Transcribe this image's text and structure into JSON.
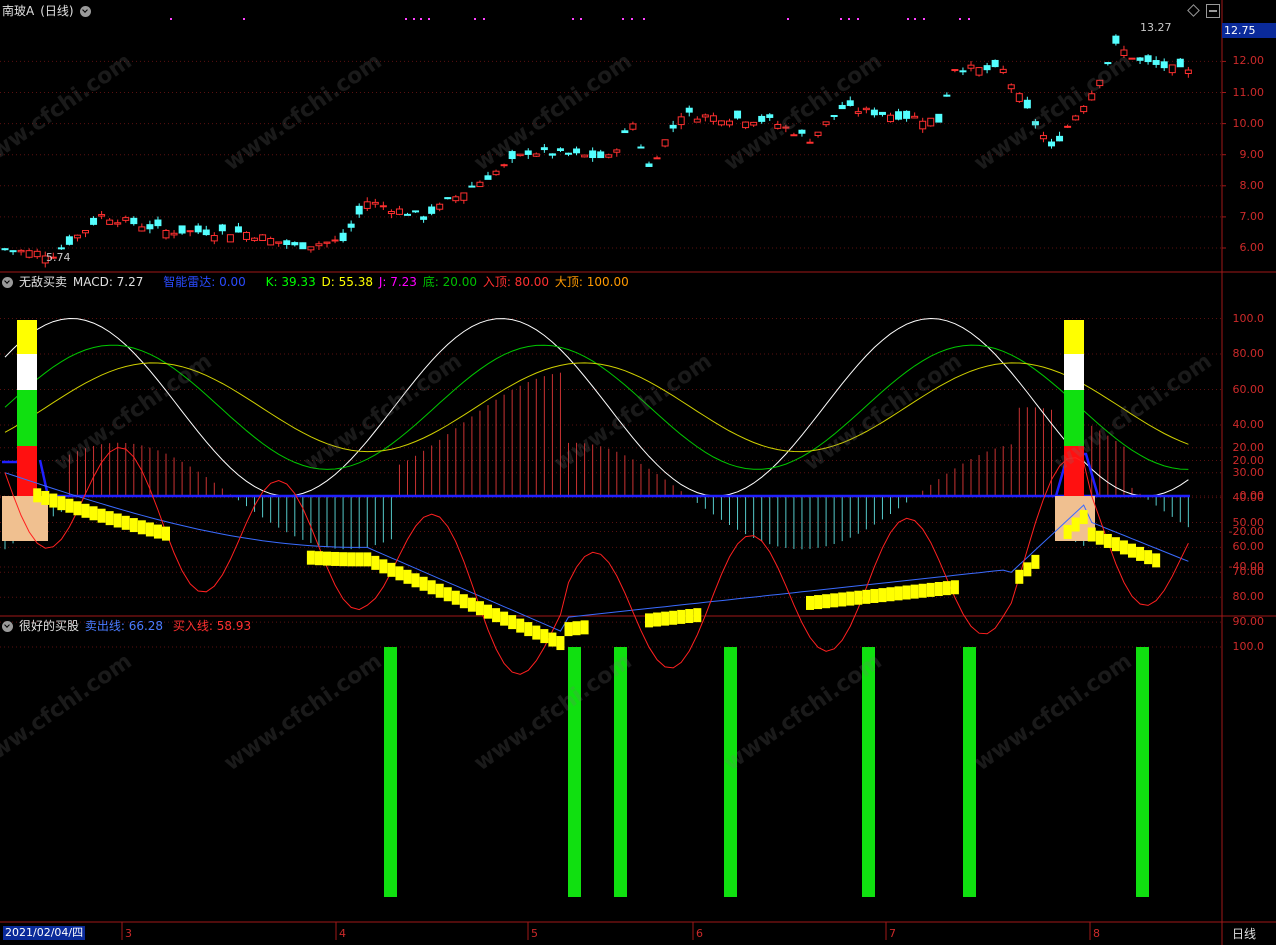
{
  "header": {
    "stock_name": "南玻A",
    "period": "(日线)"
  },
  "price_panel": {
    "current_price_tag": "12.75",
    "high_marker": "13.27",
    "low_marker": "5.74",
    "y_ticks": [
      "12.00",
      "11.00",
      "10.00",
      "9.00",
      "8.00",
      "7.00",
      "6.00"
    ]
  },
  "indicator1": {
    "name": "无敌买卖",
    "macd": "MACD: 7.27",
    "radar": "智能雷达: 0.00",
    "k": "K: 39.33",
    "d": "D: 55.38",
    "j": "J: 7.23",
    "bottom": "底: 20.00",
    "entry_top": "入顶: 80.00",
    "big_top": "大顶: 100.00",
    "y_ticks": [
      "100.0",
      "80.00",
      "60.00",
      "40.00",
      "20.00",
      "0.00",
      "-20.00",
      "-40.00"
    ],
    "colors": {
      "macd": "#c8c8c8",
      "radar": "#2a4bff",
      "k": "#00ff00",
      "d": "#ffff00",
      "j": "#ff00ff",
      "bottom": "#00c000",
      "entry_top": "#ff3030",
      "big_top": "#ff9900"
    }
  },
  "indicator2": {
    "name": "很好的买股",
    "sell_line": "卖出线: 66.28",
    "buy_line": "买入线: 58.93",
    "y_ticks": [
      "100.0",
      "90.00",
      "80.00",
      "70.00",
      "60.00",
      "50.00",
      "40.00",
      "30.00",
      "20.00"
    ],
    "colors": {
      "sell_line": "#4a7bff",
      "buy_line": "#ff3030"
    }
  },
  "x_axis": {
    "date_box": "2021/02/04/四",
    "month_labels": [
      "3",
      "4",
      "5",
      "6",
      "7",
      "8"
    ],
    "period_tab": "日线"
  },
  "watermark": "www.cfchi.com"
}
